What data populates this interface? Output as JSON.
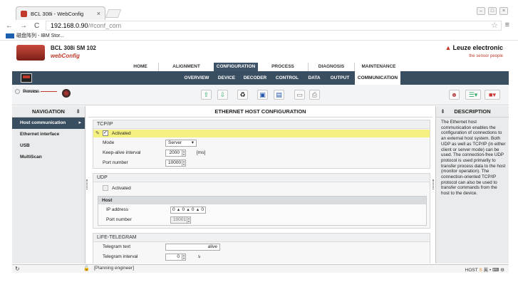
{
  "browser": {
    "tab_title": "BCL 308i - WebConfig",
    "tab_close": "×",
    "url_host": "192.168.0.90",
    "url_path": "/#conf_com",
    "bookmark": "磁盘阵列 - IBM Stor..."
  },
  "app": {
    "device_name": "BCL 308i SM 102",
    "app_name": "webConfig",
    "brand": "Leuze electronic",
    "slogan": "the sensor people"
  },
  "main_nav": [
    "HOME",
    "ALIGNMENT",
    "CONFIGURATION",
    "PROCESS",
    "DIAGNOSIS",
    "MAINTENANCE"
  ],
  "main_nav_active": "CONFIGURATION",
  "sub_nav": [
    "OVERVIEW",
    "DEVICE",
    "DECODER",
    "CONTROL",
    "DATA",
    "OUTPUT",
    "COMMUNICATION"
  ],
  "sub_nav_active": "COMMUNICATION",
  "mode": {
    "service": "Service",
    "process": "Process"
  },
  "navigation": {
    "title": "NAVIGATION",
    "items": [
      "Host communication",
      "Ethernet interface",
      "USB",
      "MultiScan"
    ],
    "active": "Host communication"
  },
  "main": {
    "title": "ETHERNET HOST CONFIGURATION",
    "tcpip": {
      "title": "TCP/IP",
      "activated_label": "Activated",
      "mode_label": "Mode",
      "mode_value": "Server",
      "keepalive_label": "Keep-alive interval",
      "keepalive_value": "2000",
      "keepalive_unit": "[ms]",
      "port_label": "Port number",
      "port_value": "10000"
    },
    "udp": {
      "title": "UDP",
      "activated_label": "Activated",
      "host_title": "Host",
      "ip_label": "IP address",
      "ip_octets": [
        "0",
        "0",
        "0",
        "0"
      ],
      "port_label": "Port number",
      "port_value": "10001"
    },
    "life": {
      "title": "LIFE-TELEGRAM",
      "text_label": "Telegram text",
      "text_value": "alive",
      "interval_label": "Telegram interval",
      "interval_value": "0",
      "interval_unit": "s"
    }
  },
  "description": {
    "title": "DESCRIPTION",
    "text": "The Ethernet host communication enables the configuration of connections to an external host system. Both UDP as well as TCP/IP (in either client or server mode) can be used. The connection-free UDP protocol is used primarily to transfer process data to the host (monitor operation). The connection-oriented TCP/IP protocol can also be used to transfer commands from the host to the device."
  },
  "statusbar": {
    "role": "[Planning engineer]",
    "host": "HOST"
  }
}
